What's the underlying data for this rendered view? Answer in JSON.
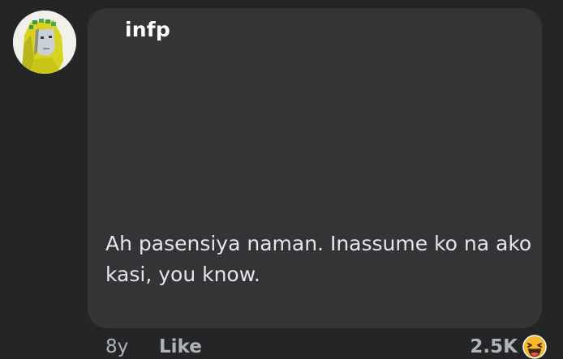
{
  "comment": {
    "author": "infp",
    "text": "Ah pasensiya naman. Inassume ko na ako kasi, you know.",
    "timestamp": "8y",
    "like_label": "Like",
    "reaction_count": "2.5K",
    "reaction_icon": "haha-emoji-icon",
    "avatar_icon": "pixel-art-character-avatar"
  },
  "colors": {
    "background": "#242526",
    "bubble": "#333436",
    "author_text": "#ffffff",
    "body_text": "#e4e6eb",
    "meta_text": "#b0b3b8",
    "reaction_yellow": "#f7b928"
  }
}
